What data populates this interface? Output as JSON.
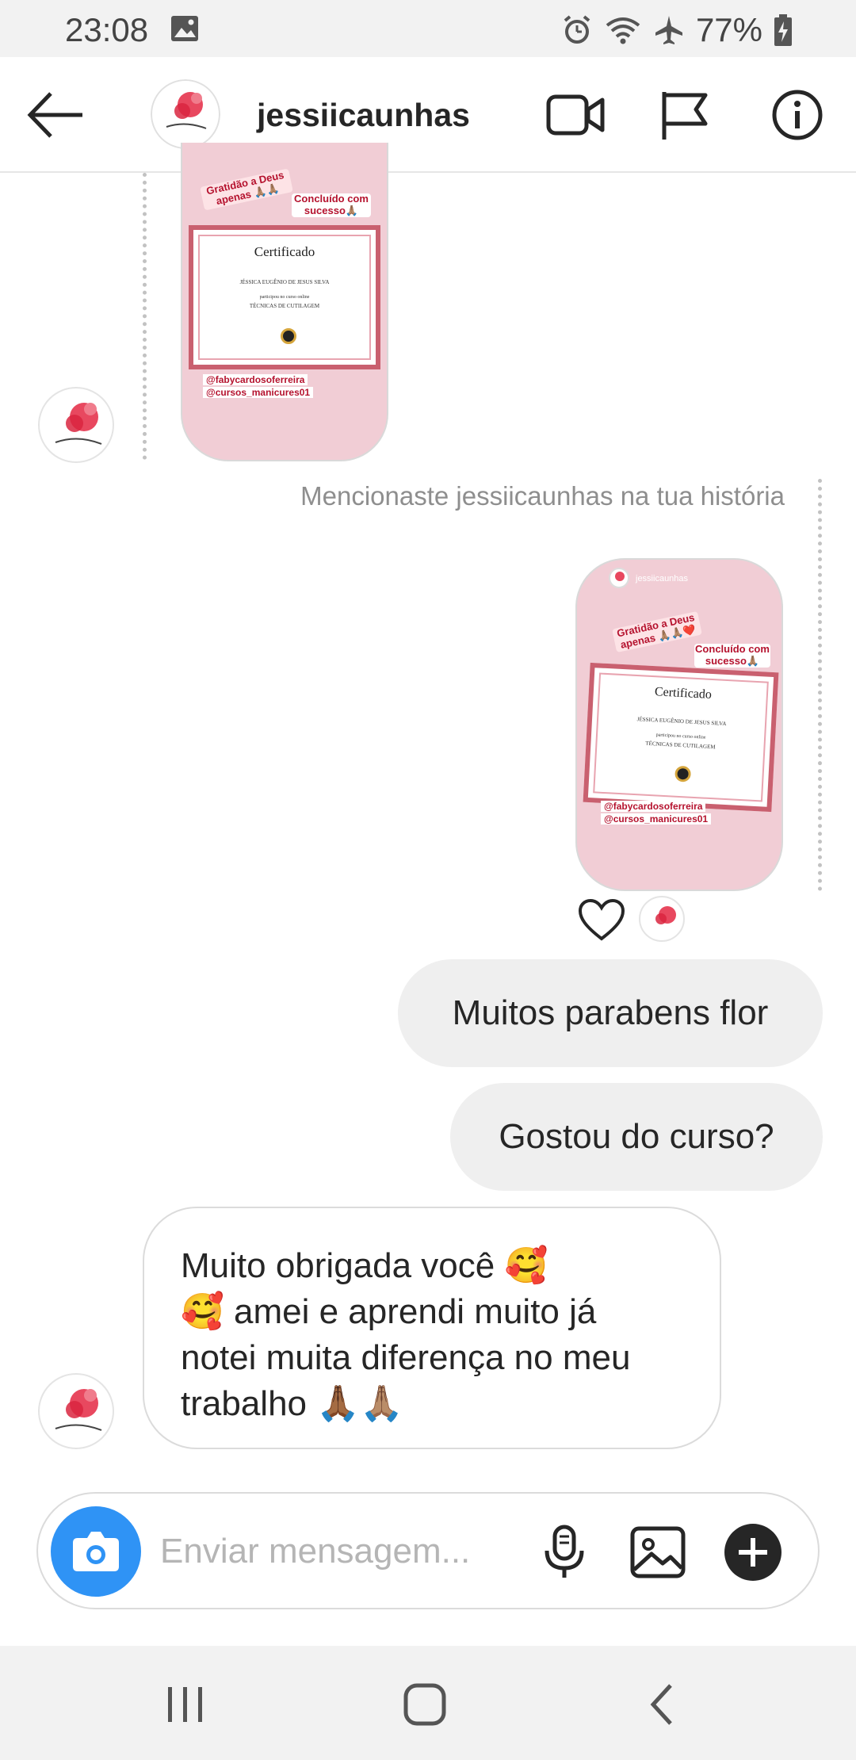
{
  "status_bar": {
    "time": "23:08",
    "battery": "77%"
  },
  "header": {
    "username": "jessiicaunhas"
  },
  "story1": {
    "sticker_left": "Gratidão a Deus apenas 🙏🏽🙏🏽",
    "sticker_right": "Concluído com sucesso🙏🏽",
    "cert_title": "Certificado",
    "cert_name": "JÉSSICA EUGÊNIO DE JESUS SILVA",
    "cert_course_pre": "participou no curso online",
    "cert_course": "TÉCNICAS DE CUTILAGEM",
    "tag1": "@fabycardosoferreira",
    "tag2": "@cursos_manicures01"
  },
  "mention": "Mencionaste jessiicaunhas na tua história",
  "story2": {
    "username": "jessiicaunhas",
    "sticker_left": "Gratidão a Deus apenas 🙏🏽🙏🏽❤️",
    "sticker_right": "Concluído com sucesso🙏🏽",
    "cert_title": "Certificado",
    "cert_name": "JÉSSICA EUGÊNIO DE JESUS SILVA",
    "cert_course_pre": "participou no curso online",
    "cert_course": "TÉCNICAS DE CUTILAGEM",
    "tag1": "@fabycardosoferreira",
    "tag2": "@cursos_manicures01"
  },
  "messages": {
    "out1": "Muitos parabens flor",
    "out2": "Gostou do curso?",
    "in1_line1": "Muito obrigada você 🥰",
    "in1_line2": "🥰 amei e aprendi muito já",
    "in1_line3": "notei muita diferença no meu",
    "in1_line4": "trabalho 🙏🏾🙏🏽"
  },
  "composer": {
    "placeholder": "Enviar mensagem..."
  },
  "colors": {
    "camera": "#2f93f5",
    "story_bg": "#f1cdd5",
    "cert_border": "#c9606f",
    "bubble_out": "#efefef"
  }
}
